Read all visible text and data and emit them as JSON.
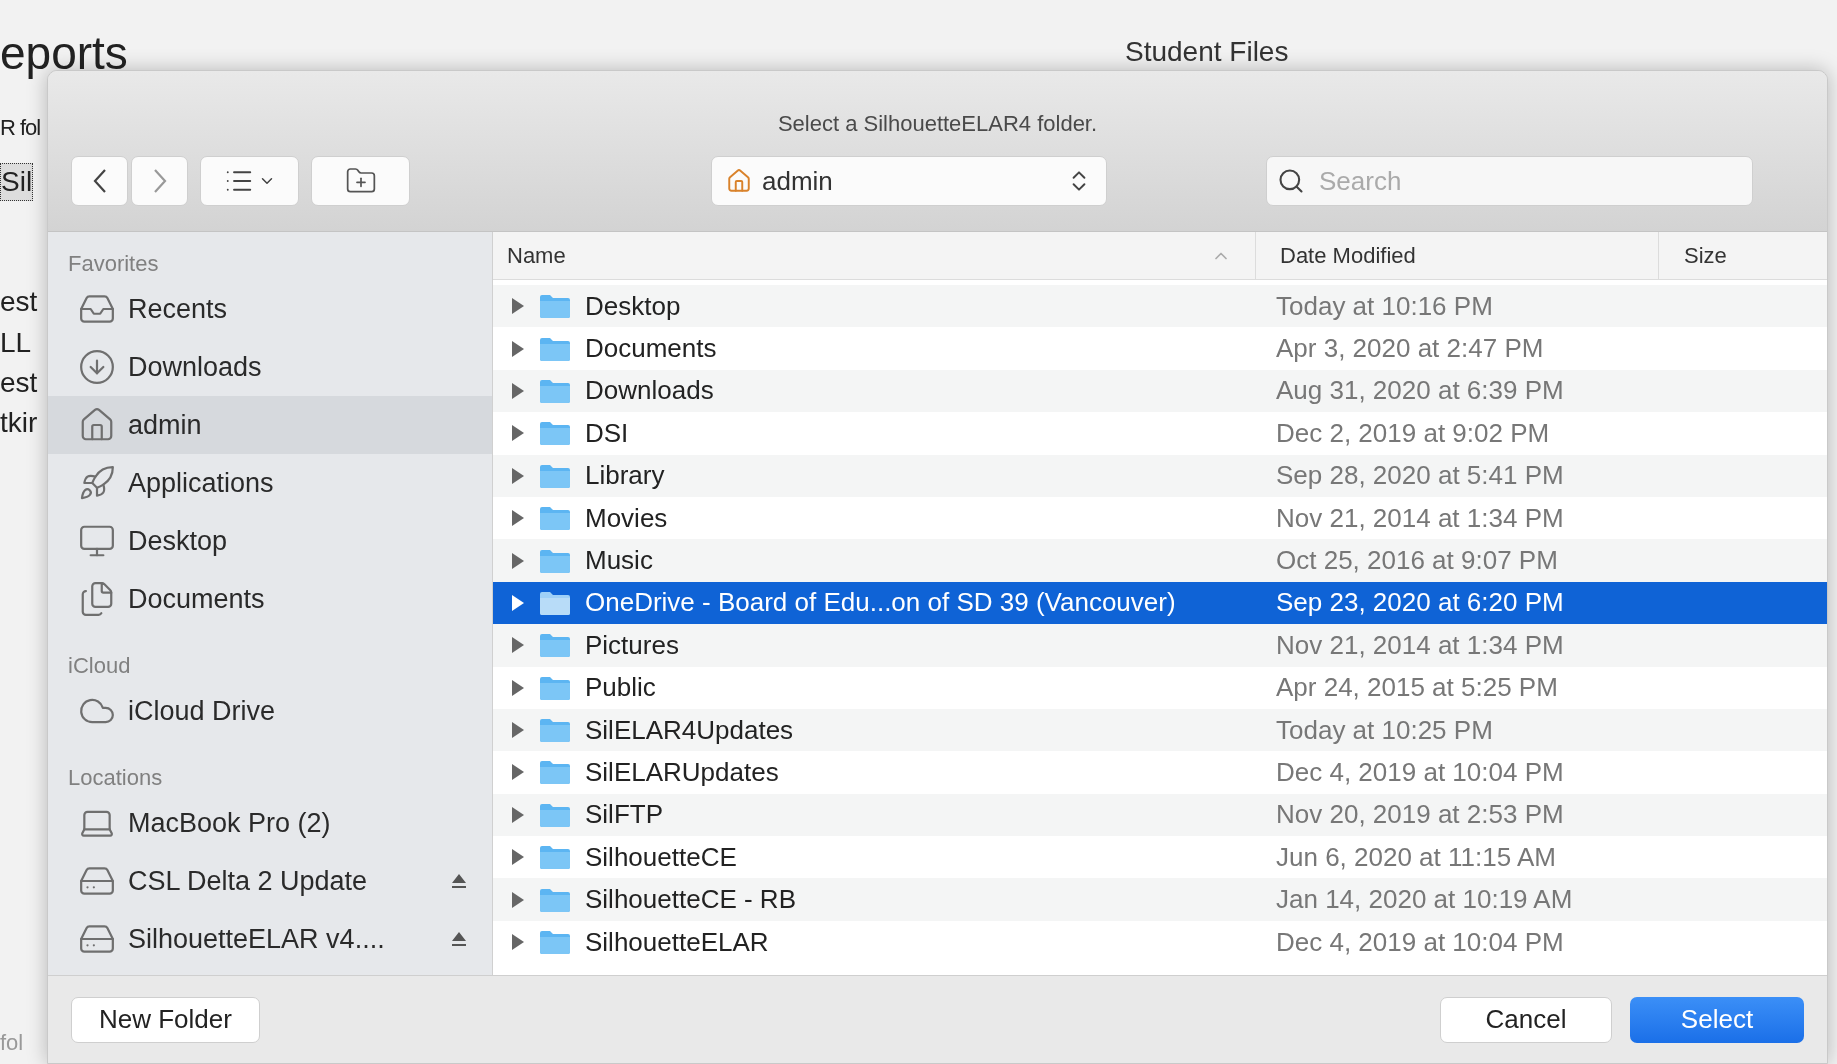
{
  "background": {
    "title": "eports",
    "heading": "Student Files",
    "lines": [
      "R fol",
      "Sil",
      "est",
      "LL",
      "est",
      "tkir"
    ],
    "footer": "fol"
  },
  "dialog": {
    "title": "Select a SilhouetteELAR4 folder.",
    "toolbar": {
      "location": "admin",
      "search": {
        "placeholder": "Search"
      }
    },
    "sidebar": [
      {
        "heading": "Favorites",
        "items": [
          {
            "label": "Recents",
            "selected": false,
            "ejectable": false
          },
          {
            "label": "Downloads",
            "selected": false,
            "ejectable": false
          },
          {
            "label": "admin",
            "selected": true,
            "ejectable": false
          },
          {
            "label": "Applications",
            "selected": false,
            "ejectable": false
          },
          {
            "label": "Desktop",
            "selected": false,
            "ejectable": false
          },
          {
            "label": "Documents",
            "selected": false,
            "ejectable": false
          }
        ]
      },
      {
        "heading": "iCloud",
        "items": [
          {
            "label": "iCloud Drive",
            "selected": false,
            "ejectable": false
          }
        ]
      },
      {
        "heading": "Locations",
        "items": [
          {
            "label": "MacBook Pro (2)",
            "selected": false,
            "ejectable": false
          },
          {
            "label": "CSL Delta 2 Update",
            "selected": false,
            "ejectable": true
          },
          {
            "label": "SilhouetteELAR v4....",
            "selected": false,
            "ejectable": true
          }
        ]
      }
    ],
    "table": {
      "columns": [
        "Name",
        "Date Modified",
        "Size"
      ],
      "rows": [
        {
          "name": "Desktop",
          "date": "Today at 10:16 PM",
          "selected": false
        },
        {
          "name": "Documents",
          "date": "Apr 3, 2020 at 2:47 PM",
          "selected": false
        },
        {
          "name": "Downloads",
          "date": "Aug 31, 2020 at 6:39 PM",
          "selected": false
        },
        {
          "name": "DSI",
          "date": "Dec 2, 2019 at 9:02 PM",
          "selected": false
        },
        {
          "name": "Library",
          "date": "Sep 28, 2020 at 5:41 PM",
          "selected": false
        },
        {
          "name": "Movies",
          "date": "Nov 21, 2014 at 1:34 PM",
          "selected": false
        },
        {
          "name": "Music",
          "date": "Oct 25, 2016 at 9:07 PM",
          "selected": false
        },
        {
          "name": "OneDrive - Board of Edu...on of SD 39 (Vancouver)",
          "date": "Sep 23, 2020 at 6:20 PM",
          "selected": true
        },
        {
          "name": "Pictures",
          "date": "Nov 21, 2014 at 1:34 PM",
          "selected": false
        },
        {
          "name": "Public",
          "date": "Apr 24, 2015 at 5:25 PM",
          "selected": false
        },
        {
          "name": "SilELAR4Updates",
          "date": "Today at 10:25 PM",
          "selected": false
        },
        {
          "name": "SilELARUpdates",
          "date": "Dec 4, 2019 at 10:04 PM",
          "selected": false
        },
        {
          "name": "SilFTP",
          "date": "Nov 20, 2019 at 2:53 PM",
          "selected": false
        },
        {
          "name": "SilhouetteCE",
          "date": "Jun 6, 2020 at 11:15 AM",
          "selected": false
        },
        {
          "name": "SilhouetteCE - RB",
          "date": "Jan 14, 2020 at 10:19 AM",
          "selected": false
        },
        {
          "name": "SilhouetteELAR",
          "date": "Dec 4, 2019 at 10:04 PM",
          "selected": false
        }
      ]
    },
    "buttons": {
      "new_folder": "New Folder",
      "cancel": "Cancel",
      "select": "Select"
    }
  }
}
